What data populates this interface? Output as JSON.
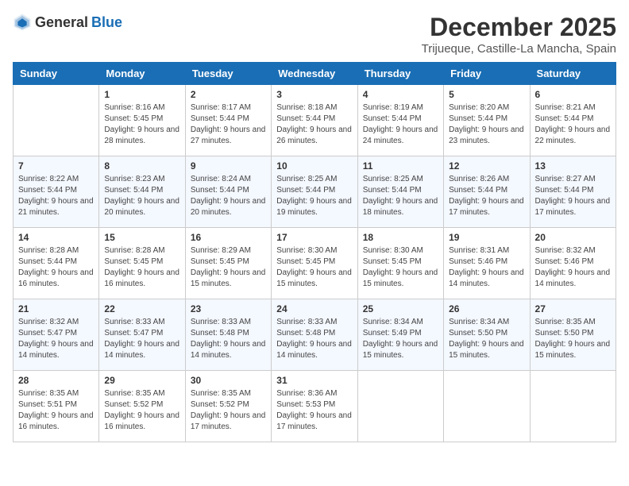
{
  "header": {
    "logo_general": "General",
    "logo_blue": "Blue",
    "month_title": "December 2025",
    "location": "Trijueque, Castille-La Mancha, Spain"
  },
  "weekdays": [
    "Sunday",
    "Monday",
    "Tuesday",
    "Wednesday",
    "Thursday",
    "Friday",
    "Saturday"
  ],
  "weeks": [
    [
      {
        "day": "",
        "sunrise": "",
        "sunset": "",
        "daylight": ""
      },
      {
        "day": "1",
        "sunrise": "Sunrise: 8:16 AM",
        "sunset": "Sunset: 5:45 PM",
        "daylight": "Daylight: 9 hours and 28 minutes."
      },
      {
        "day": "2",
        "sunrise": "Sunrise: 8:17 AM",
        "sunset": "Sunset: 5:44 PM",
        "daylight": "Daylight: 9 hours and 27 minutes."
      },
      {
        "day": "3",
        "sunrise": "Sunrise: 8:18 AM",
        "sunset": "Sunset: 5:44 PM",
        "daylight": "Daylight: 9 hours and 26 minutes."
      },
      {
        "day": "4",
        "sunrise": "Sunrise: 8:19 AM",
        "sunset": "Sunset: 5:44 PM",
        "daylight": "Daylight: 9 hours and 24 minutes."
      },
      {
        "day": "5",
        "sunrise": "Sunrise: 8:20 AM",
        "sunset": "Sunset: 5:44 PM",
        "daylight": "Daylight: 9 hours and 23 minutes."
      },
      {
        "day": "6",
        "sunrise": "Sunrise: 8:21 AM",
        "sunset": "Sunset: 5:44 PM",
        "daylight": "Daylight: 9 hours and 22 minutes."
      }
    ],
    [
      {
        "day": "7",
        "sunrise": "Sunrise: 8:22 AM",
        "sunset": "Sunset: 5:44 PM",
        "daylight": "Daylight: 9 hours and 21 minutes."
      },
      {
        "day": "8",
        "sunrise": "Sunrise: 8:23 AM",
        "sunset": "Sunset: 5:44 PM",
        "daylight": "Daylight: 9 hours and 20 minutes."
      },
      {
        "day": "9",
        "sunrise": "Sunrise: 8:24 AM",
        "sunset": "Sunset: 5:44 PM",
        "daylight": "Daylight: 9 hours and 20 minutes."
      },
      {
        "day": "10",
        "sunrise": "Sunrise: 8:25 AM",
        "sunset": "Sunset: 5:44 PM",
        "daylight": "Daylight: 9 hours and 19 minutes."
      },
      {
        "day": "11",
        "sunrise": "Sunrise: 8:25 AM",
        "sunset": "Sunset: 5:44 PM",
        "daylight": "Daylight: 9 hours and 18 minutes."
      },
      {
        "day": "12",
        "sunrise": "Sunrise: 8:26 AM",
        "sunset": "Sunset: 5:44 PM",
        "daylight": "Daylight: 9 hours and 17 minutes."
      },
      {
        "day": "13",
        "sunrise": "Sunrise: 8:27 AM",
        "sunset": "Sunset: 5:44 PM",
        "daylight": "Daylight: 9 hours and 17 minutes."
      }
    ],
    [
      {
        "day": "14",
        "sunrise": "Sunrise: 8:28 AM",
        "sunset": "Sunset: 5:44 PM",
        "daylight": "Daylight: 9 hours and 16 minutes."
      },
      {
        "day": "15",
        "sunrise": "Sunrise: 8:28 AM",
        "sunset": "Sunset: 5:45 PM",
        "daylight": "Daylight: 9 hours and 16 minutes."
      },
      {
        "day": "16",
        "sunrise": "Sunrise: 8:29 AM",
        "sunset": "Sunset: 5:45 PM",
        "daylight": "Daylight: 9 hours and 15 minutes."
      },
      {
        "day": "17",
        "sunrise": "Sunrise: 8:30 AM",
        "sunset": "Sunset: 5:45 PM",
        "daylight": "Daylight: 9 hours and 15 minutes."
      },
      {
        "day": "18",
        "sunrise": "Sunrise: 8:30 AM",
        "sunset": "Sunset: 5:45 PM",
        "daylight": "Daylight: 9 hours and 15 minutes."
      },
      {
        "day": "19",
        "sunrise": "Sunrise: 8:31 AM",
        "sunset": "Sunset: 5:46 PM",
        "daylight": "Daylight: 9 hours and 14 minutes."
      },
      {
        "day": "20",
        "sunrise": "Sunrise: 8:32 AM",
        "sunset": "Sunset: 5:46 PM",
        "daylight": "Daylight: 9 hours and 14 minutes."
      }
    ],
    [
      {
        "day": "21",
        "sunrise": "Sunrise: 8:32 AM",
        "sunset": "Sunset: 5:47 PM",
        "daylight": "Daylight: 9 hours and 14 minutes."
      },
      {
        "day": "22",
        "sunrise": "Sunrise: 8:33 AM",
        "sunset": "Sunset: 5:47 PM",
        "daylight": "Daylight: 9 hours and 14 minutes."
      },
      {
        "day": "23",
        "sunrise": "Sunrise: 8:33 AM",
        "sunset": "Sunset: 5:48 PM",
        "daylight": "Daylight: 9 hours and 14 minutes."
      },
      {
        "day": "24",
        "sunrise": "Sunrise: 8:33 AM",
        "sunset": "Sunset: 5:48 PM",
        "daylight": "Daylight: 9 hours and 14 minutes."
      },
      {
        "day": "25",
        "sunrise": "Sunrise: 8:34 AM",
        "sunset": "Sunset: 5:49 PM",
        "daylight": "Daylight: 9 hours and 15 minutes."
      },
      {
        "day": "26",
        "sunrise": "Sunrise: 8:34 AM",
        "sunset": "Sunset: 5:50 PM",
        "daylight": "Daylight: 9 hours and 15 minutes."
      },
      {
        "day": "27",
        "sunrise": "Sunrise: 8:35 AM",
        "sunset": "Sunset: 5:50 PM",
        "daylight": "Daylight: 9 hours and 15 minutes."
      }
    ],
    [
      {
        "day": "28",
        "sunrise": "Sunrise: 8:35 AM",
        "sunset": "Sunset: 5:51 PM",
        "daylight": "Daylight: 9 hours and 16 minutes."
      },
      {
        "day": "29",
        "sunrise": "Sunrise: 8:35 AM",
        "sunset": "Sunset: 5:52 PM",
        "daylight": "Daylight: 9 hours and 16 minutes."
      },
      {
        "day": "30",
        "sunrise": "Sunrise: 8:35 AM",
        "sunset": "Sunset: 5:52 PM",
        "daylight": "Daylight: 9 hours and 17 minutes."
      },
      {
        "day": "31",
        "sunrise": "Sunrise: 8:36 AM",
        "sunset": "Sunset: 5:53 PM",
        "daylight": "Daylight: 9 hours and 17 minutes."
      },
      {
        "day": "",
        "sunrise": "",
        "sunset": "",
        "daylight": ""
      },
      {
        "day": "",
        "sunrise": "",
        "sunset": "",
        "daylight": ""
      },
      {
        "day": "",
        "sunrise": "",
        "sunset": "",
        "daylight": ""
      }
    ]
  ]
}
